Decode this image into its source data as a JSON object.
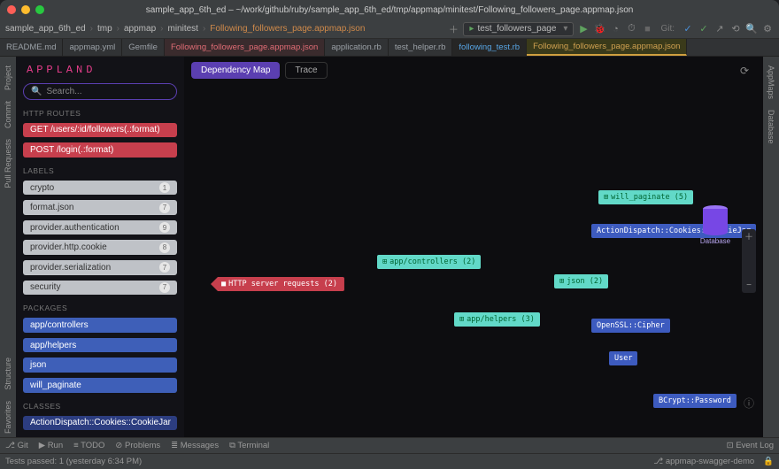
{
  "window": {
    "title": "sample_app_6th_ed – ~/work/github/ruby/sample_app_6th_ed/tmp/appmap/minitest/Following_followers_page.appmap.json",
    "traffic": {
      "close": "#ff5f57",
      "min": "#febc2e",
      "max": "#28c840"
    }
  },
  "breadcrumbs": [
    "sample_app_6th_ed",
    "tmp",
    "appmap",
    "minitest",
    "Following_followers_page.appmap.json"
  ],
  "run_config": {
    "label": "test_followers_page"
  },
  "file_tabs": [
    {
      "name": "README.md",
      "kind": "md"
    },
    {
      "name": "appmap.yml",
      "kind": "yml"
    },
    {
      "name": "Gemfile",
      "kind": "rb"
    },
    {
      "name": "Following_followers_page.appmap.json",
      "kind": "json",
      "hl": true
    },
    {
      "name": "application.rb",
      "kind": "rb"
    },
    {
      "name": "test_helper.rb",
      "kind": "rb"
    },
    {
      "name": "following_test.rb",
      "kind": "rb",
      "active": true
    },
    {
      "name": "Following_followers_page.appmap.json",
      "kind": "json",
      "sel": true
    }
  ],
  "sidebar": {
    "logo": "APPLAND",
    "search_placeholder": "Search...",
    "sections": {
      "routes_hdr": "HTTP ROUTES",
      "routes": [
        {
          "label": "GET /users/:id/followers(.:format)"
        },
        {
          "label": "POST /login(.:format)"
        }
      ],
      "labels_hdr": "LABELS",
      "labels": [
        {
          "label": "crypto",
          "count": 1
        },
        {
          "label": "format.json",
          "count": 7
        },
        {
          "label": "provider.authentication",
          "count": 9
        },
        {
          "label": "provider.http.cookie",
          "count": 8
        },
        {
          "label": "provider.serialization",
          "count": 7
        },
        {
          "label": "security",
          "count": 7
        }
      ],
      "packages_hdr": "PACKAGES",
      "packages": [
        {
          "label": "app/controllers"
        },
        {
          "label": "app/helpers"
        },
        {
          "label": "json"
        },
        {
          "label": "will_paginate"
        }
      ],
      "classes_hdr": "CLASSES",
      "classes": [
        {
          "label": "ActionDispatch::Cookies::CookieJar"
        }
      ]
    }
  },
  "canvas": {
    "tabs": {
      "dep": "Dependency Map",
      "trace": "Trace"
    },
    "nodes": {
      "req": "HTTP server requests (2)",
      "controllers": "app/controllers (2)",
      "helpers": "app/helpers (3)",
      "will_paginate": "will_paginate (5)",
      "json": "json (2)",
      "cookiejar": "ActionDispatch::Cookies::CookieJar",
      "cipher": "OpenSSL::Cipher",
      "user": "User",
      "bcrypt": "BCrypt::Password",
      "db": "Database"
    }
  },
  "tool_strip": {
    "git": "Git",
    "run": "Run",
    "todo": "TODO",
    "problems": "Problems",
    "messages": "Messages",
    "terminal": "Terminal"
  },
  "status": {
    "left": "Tests passed: 1 (yesterday 6:34 PM)",
    "event_log": "Event Log",
    "branch": "appmap-swagger-demo"
  },
  "gutters": {
    "left": [
      "Project",
      "Commit",
      "Pull Requests",
      "Structure",
      "Favorites"
    ],
    "right": [
      "AppMaps",
      "Database"
    ]
  }
}
